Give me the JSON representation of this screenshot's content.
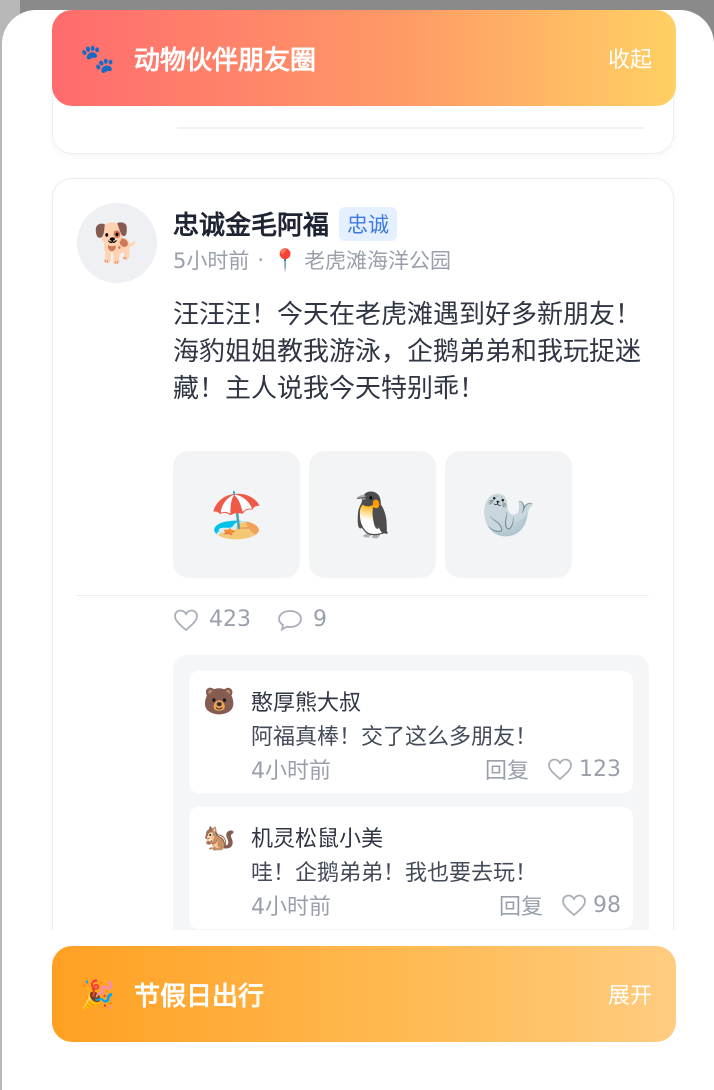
{
  "top_banner": {
    "icon": "🐾",
    "title": "动物伙伴朋友圈",
    "action": "收起"
  },
  "post": {
    "avatar": "🐕",
    "name": "忠诚金毛阿福",
    "tag": "忠诚",
    "time": "5小时前",
    "separator": "·",
    "pin_icon": "📍",
    "location": "老虎滩海洋公园",
    "content": "汪汪汪！今天在老虎滩遇到好多新朋友！海豹姐姐教我游泳，企鹅弟弟和我玩捉迷藏！主人说我今天特别乖！",
    "images": [
      "🏖️",
      "🐧",
      "🦭"
    ],
    "likes": "423",
    "comments_count": "9"
  },
  "comments": [
    {
      "avatar": "🐻",
      "name": "憨厚熊大叔",
      "text": "阿福真棒！交了这么多朋友！",
      "time": "4小时前",
      "reply": "回复",
      "likes": "123"
    },
    {
      "avatar": "🐿️",
      "name": "机灵松鼠小美",
      "text": "哇！企鹅弟弟！我也要去玩！",
      "time": "4小时前",
      "reply": "回复",
      "likes": "98"
    }
  ],
  "bottom_banner": {
    "icon": "🎉",
    "title": "节假日出行",
    "action": "展开"
  }
}
